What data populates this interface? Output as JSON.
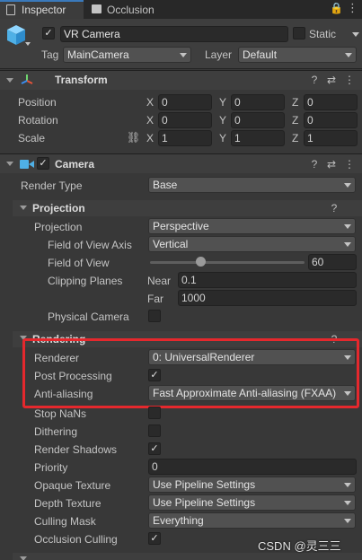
{
  "tabs": {
    "inspector": "Inspector",
    "occlusion": "Occlusion"
  },
  "gameobject": {
    "name": "VR Camera",
    "static_label": "Static",
    "tag_label": "Tag",
    "tag_value": "MainCamera",
    "layer_label": "Layer",
    "layer_value": "Default"
  },
  "transform": {
    "title": "Transform",
    "rows": [
      {
        "label": "Position",
        "x": "0",
        "y": "0",
        "z": "0"
      },
      {
        "label": "Rotation",
        "x": "0",
        "y": "0",
        "z": "0"
      },
      {
        "label": "Scale",
        "x": "1",
        "y": "1",
        "z": "1"
      }
    ],
    "axis": {
      "x": "X",
      "y": "Y",
      "z": "Z"
    }
  },
  "camera": {
    "title": "Camera",
    "render_type_label": "Render Type",
    "render_type_value": "Base",
    "projection_section": "Projection",
    "projection_label": "Projection",
    "projection_value": "Perspective",
    "fov_axis_label": "Field of View Axis",
    "fov_axis_value": "Vertical",
    "fov_label": "Field of View",
    "fov_value": "60",
    "fov_slider_fraction": 0.33,
    "clipping_label": "Clipping Planes",
    "near_label": "Near",
    "near_value": "0.1",
    "far_label": "Far",
    "far_value": "1000",
    "physical_label": "Physical Camera",
    "rendering_section": "Rendering",
    "renderer_label": "Renderer",
    "renderer_value": "0: UniversalRenderer",
    "post_label": "Post Processing",
    "aa_label": "Anti-aliasing",
    "aa_value": "Fast Approximate Anti-aliasing (FXAA)",
    "stop_nans_label": "Stop NaNs",
    "dithering_label": "Dithering",
    "render_shadows_label": "Render Shadows",
    "priority_label": "Priority",
    "priority_value": "0",
    "opaque_label": "Opaque Texture",
    "opaque_value": "Use Pipeline Settings",
    "depth_label": "Depth Texture",
    "depth_value": "Use Pipeline Settings",
    "culling_label": "Culling Mask",
    "culling_value": "Everything",
    "occlusion_label": "Occlusion Culling"
  },
  "watermark": "CSDN @灵三三",
  "colors": {
    "highlight_box": "#e5282d",
    "accent": "#3a79bb"
  }
}
